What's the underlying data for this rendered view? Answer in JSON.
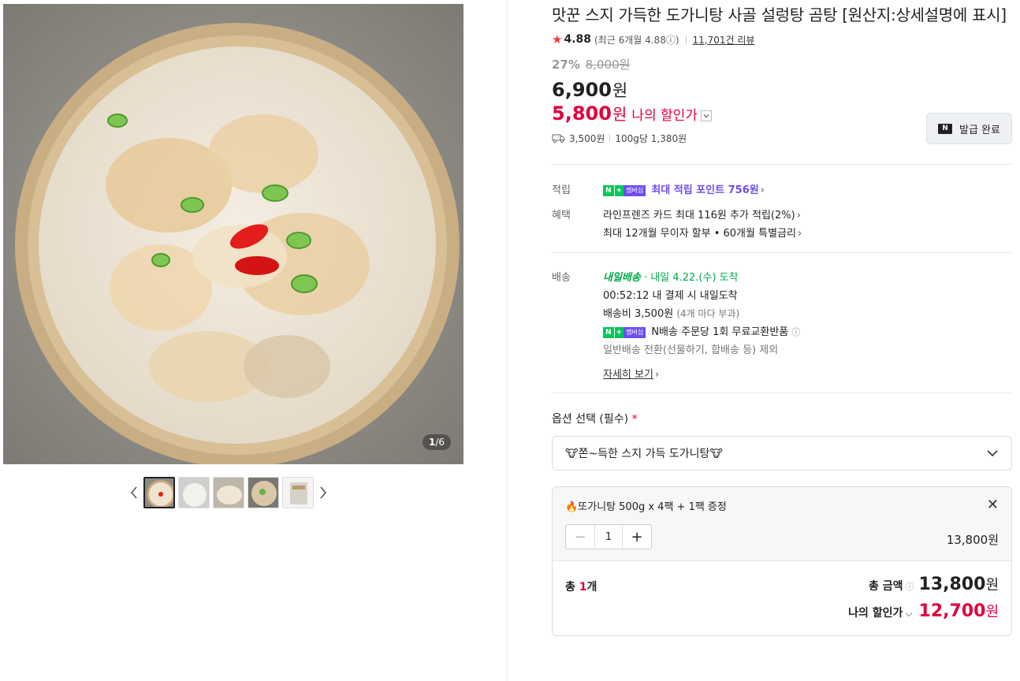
{
  "gallery": {
    "counter_current": "1",
    "counter_total": "/6",
    "thumb_count": 5
  },
  "product": {
    "title": "맛꾼 스지 가득한 도가니탕 사골 설렁탕 곰탕 [원산지:상세설명에 표시]",
    "rating": "4.88",
    "recent_rating": "(최근 6개월 4.88ⓘ)",
    "reviews": "11,701건 리뷰",
    "discount_rate": "27%",
    "original_price": "8,000원",
    "price": "6,900",
    "price_unit": "원",
    "my_price": "5,800",
    "my_price_unit": "원",
    "my_price_label": "나의 할인가",
    "coupon_badge": "N",
    "coupon_label": "발급 완료",
    "shipping_fee": "3,500원",
    "unit_price": "100g당 1,380원"
  },
  "points": {
    "key": "적립",
    "badge_n": "N",
    "badge_plus": "+",
    "badge_membership": "멤버십",
    "text": "최대 적립 포인트 756원"
  },
  "benefits": {
    "key": "혜택",
    "line1": "라인프렌즈 카드 최대 116원 추가 적립(2%)",
    "line2": "최대 12개월 무이자 할부 • 60개월 특별금리"
  },
  "delivery": {
    "key": "배송",
    "badge": "내일배송",
    "eta": "· 내일 4.22.(수) 도착",
    "deadline": "00:52:12  내 결제 시 내일도착",
    "fee": "배송비 3,500원",
    "fee_note": "(4개 마다 부과)",
    "nexchange": "N배송 주문당 1회 무료교환반품",
    "exclude": "일반배송 전환(선물하기, 합배송 등) 제외",
    "more": "자세히 보기"
  },
  "option": {
    "label": "옵션 선택 (필수)",
    "required_mark": "*",
    "selected": "🐮쫀~득한 스지 가득 도가니탕🐮"
  },
  "cart": {
    "item_name": "🔥또가니탕 500g x 4팩 + 1팩 증정",
    "qty": "1",
    "item_price": "13,800원",
    "count_label": "총 ",
    "count_num": "1",
    "count_unit": "개",
    "total_label": "총 금액",
    "total_value": "13,800",
    "total_unit": "원",
    "discount_label": "나의 할인가",
    "discount_value": "12,700",
    "discount_unit": "원"
  },
  "colors": {
    "accent_red": "#e0003c",
    "naver_green": "#03c75a",
    "membership_purple": "#6e4df2"
  }
}
